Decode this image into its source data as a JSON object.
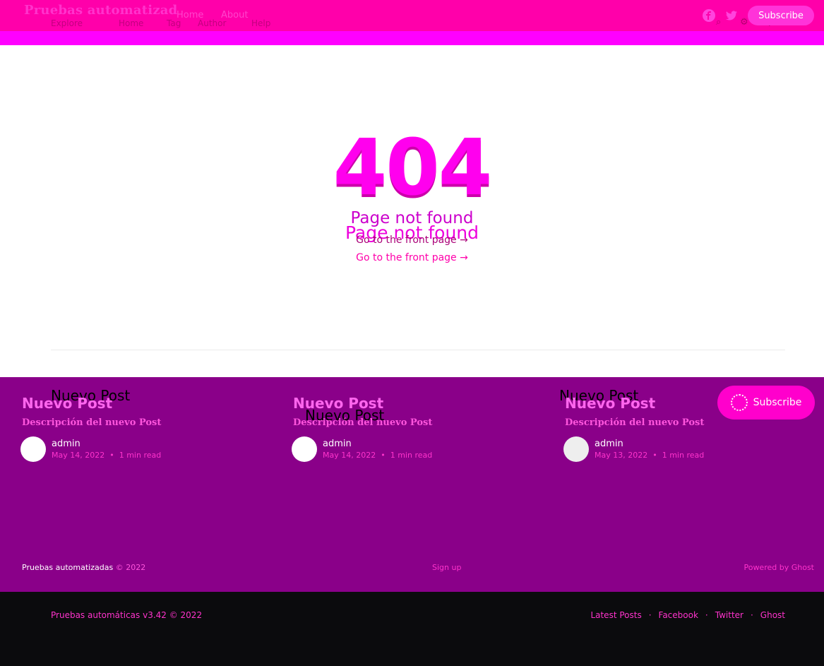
{
  "header": {
    "brand": "Pruebas automatizad",
    "old_nav": [
      "Explore",
      "Home",
      "Tag",
      "Author",
      "Help"
    ],
    "nav": [
      "Home",
      "About"
    ],
    "subscribe_label": "Subscribe",
    "icons": [
      "facebook-icon",
      "twitter-icon",
      "search-icon",
      "settings-icon",
      "rss-icon"
    ]
  },
  "error": {
    "code": "404",
    "message": "Page not found",
    "link": "Go to the front page →"
  },
  "cards": [
    {
      "title": "Nuevo Post",
      "description": "Descripción del nuevo Post",
      "author": "admin",
      "date": "May 14, 2022",
      "read": "1 min read"
    },
    {
      "title": "Nuevo Post",
      "description": "Descripción del nuevo Post",
      "author": "admin",
      "date": "May 14, 2022",
      "read": "1 min read"
    },
    {
      "title": "Nuevo Post",
      "description": "Descripción del nuevo Post",
      "author": "admin",
      "date": "May 13, 2022",
      "read": "1 min read"
    }
  ],
  "subscribe_big_label": "Subscribe",
  "purple_footer": {
    "site": "Pruebas automatizadas",
    "year": "© 2022",
    "signup": "Sign up",
    "powered": "Powered by Ghost"
  },
  "dark_footer": {
    "left": "Pruebas automáticas v3.42 © 2022",
    "links": [
      "Latest Posts",
      "Facebook",
      "Twitter",
      "Ghost"
    ]
  },
  "colors": {
    "header_pink": "#ff00aa",
    "accent_magenta": "#ff00ff",
    "purple_section": "#8a0089",
    "dark_footer": "#0b0b0d"
  }
}
